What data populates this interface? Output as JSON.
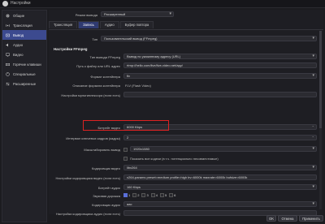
{
  "window": {
    "title": "Настройки"
  },
  "sidebar": {
    "items": [
      {
        "label": "Общие",
        "icon": "gear-icon"
      },
      {
        "label": "Трансляция",
        "icon": "broadcast-icon"
      },
      {
        "label": "Вывод",
        "icon": "output-icon",
        "active": true
      },
      {
        "label": "Аудио",
        "icon": "speaker-icon"
      },
      {
        "label": "Видео",
        "icon": "monitor-icon"
      },
      {
        "label": "Горячие клавиши",
        "icon": "keyboard-icon"
      },
      {
        "label": "Специальные",
        "icon": "accessibility-icon"
      },
      {
        "label": "Расширенные",
        "icon": "advanced-icon"
      }
    ]
  },
  "output": {
    "mode_label": "Режим вывода",
    "mode_value": "Расширенный",
    "tabs": [
      {
        "label": "Трансляция"
      },
      {
        "label": "Запись",
        "active": true
      },
      {
        "label": "Аудио"
      },
      {
        "label": "Буфер повтора"
      }
    ],
    "type_label": "Тип",
    "type_value": "Пользовательский вывод (FFmpeg)",
    "section_title": "Настройки FFmpeg",
    "fields": [
      {
        "label": "Тип вывода FFmpeg",
        "value": "Вывод по указанному адресу (URL)",
        "kind": "dropdown"
      },
      {
        "label": "Путь к файлу или URL адрес",
        "value": "rtmp://hello.com/live/live-video.net/apy/",
        "kind": "text"
      },
      {
        "label": "Формат контейнера",
        "value": "flv",
        "kind": "dropdown"
      },
      {
        "label": "Описание формата контейнера",
        "value": "FLV (Flash Video)",
        "kind": "static"
      },
      {
        "label": "Настройки мультиплексора (если есть)",
        "value": "",
        "kind": "text"
      },
      {
        "label": "Битрейт видео",
        "value": "6000 Kbps",
        "kind": "spin"
      },
      {
        "label": "Интервал ключевых кадров (кадры)",
        "value": "2",
        "kind": "spin"
      },
      {
        "label": "Масштабировать вывод",
        "value": "1920x1080",
        "kind": "dropdown"
      },
      {
        "label": "",
        "value": "Показать все кодеки (в т.ч. потенциально несовместимые)",
        "kind": "check"
      },
      {
        "label": "Кодировщик видео",
        "value": "libx264",
        "kind": "dropdown"
      },
      {
        "label": "Настройки кодировщика видео (если есть)",
        "value": "x264-params preset=medium profile=high bv=6000k maxrate=6000k bufsize=6000k",
        "kind": "text"
      },
      {
        "label": "Битрейт аудио",
        "value": "160 Kbps",
        "kind": "dropdown"
      },
      {
        "label": "Звуковая дорожка",
        "value": "",
        "kind": "tracks"
      },
      {
        "label": "Кодировщик аудио",
        "value": "aac",
        "kind": "dropdown"
      },
      {
        "label": "Настройки кодировщика аудио (если есть)",
        "value": "",
        "kind": "text"
      }
    ],
    "tracks": [
      "1",
      "2",
      "3",
      "4",
      "5",
      "6"
    ]
  },
  "buttons": {
    "ok": "OK",
    "cancel": "Отмена",
    "apply": "Применить"
  }
}
